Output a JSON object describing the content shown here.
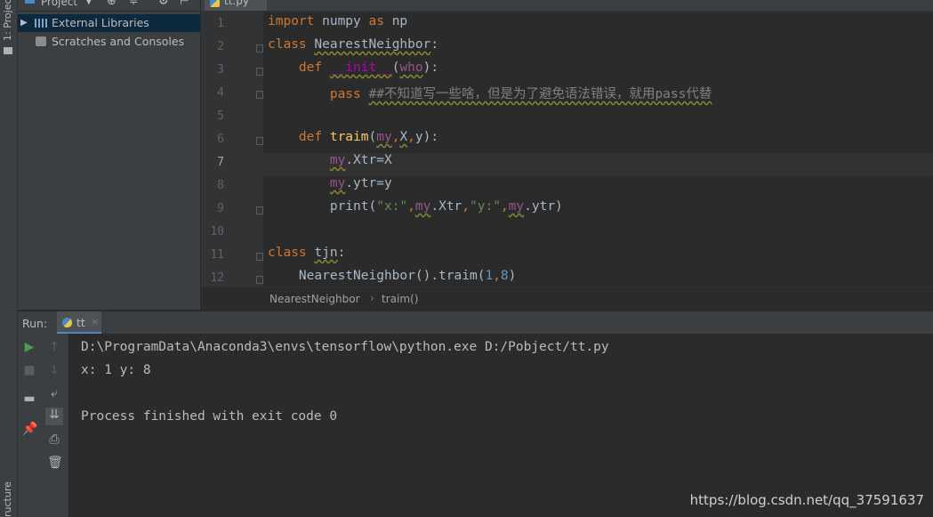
{
  "sidebar": {
    "project_tab": "1: Project",
    "structure_tab": "ructure",
    "project_title": "Project",
    "items": [
      {
        "label": "External Libraries",
        "icon": "library-icon"
      },
      {
        "label": "Scratches and Consoles",
        "icon": "scratches-icon"
      }
    ]
  },
  "editor": {
    "tab_label": "tt.py",
    "current_line": 7,
    "line_numbers": [
      "1",
      "2",
      "3",
      "4",
      "5",
      "6",
      "7",
      "8",
      "9",
      "10",
      "11",
      "12"
    ],
    "lines": [
      [
        [
          "kw",
          "import "
        ],
        [
          "t",
          "numpy "
        ],
        [
          "kw",
          "as "
        ],
        [
          "t",
          "np"
        ]
      ],
      [
        [
          "kw",
          "class "
        ],
        [
          "tw",
          "NearestNeighbor"
        ],
        [
          "t",
          ":"
        ]
      ],
      [
        [
          "t",
          "    "
        ],
        [
          "kw",
          "def "
        ],
        [
          "mw",
          "__init__"
        ],
        [
          "t",
          "("
        ],
        [
          "sw",
          "who"
        ],
        [
          "t",
          "):"
        ]
      ],
      [
        [
          "t",
          "        "
        ],
        [
          "kw",
          "pass "
        ],
        [
          "cw",
          "##不知道写一些啥，但是为了避免语法错误，就用pass代替"
        ]
      ],
      [],
      [
        [
          "t",
          "    "
        ],
        [
          "kw",
          "def "
        ],
        [
          "fn",
          "traim"
        ],
        [
          "t",
          "("
        ],
        [
          "sw",
          "my"
        ],
        [
          "kw",
          ","
        ],
        [
          "tw",
          "X"
        ],
        [
          "kw",
          ","
        ],
        [
          "t",
          "y):"
        ]
      ],
      [
        [
          "t",
          "        "
        ],
        [
          "sw",
          "my"
        ],
        [
          "t",
          ".Xtr=X"
        ]
      ],
      [
        [
          "t",
          "        "
        ],
        [
          "sw",
          "my"
        ],
        [
          "t",
          ".ytr=y"
        ]
      ],
      [
        [
          "t",
          "        "
        ],
        [
          "t",
          "print("
        ],
        [
          "str",
          "\"x:\""
        ],
        [
          "kw",
          ","
        ],
        [
          "sw",
          "my"
        ],
        [
          "t",
          ".Xtr"
        ],
        [
          "kw",
          ","
        ],
        [
          "str",
          "\"y:\""
        ],
        [
          "kw",
          ","
        ],
        [
          "sw",
          "my"
        ],
        [
          "t",
          ".ytr)"
        ]
      ],
      [],
      [
        [
          "kw",
          "class "
        ],
        [
          "tw",
          "tjn"
        ],
        [
          "t",
          ":"
        ]
      ],
      [
        [
          "t",
          "    "
        ],
        [
          "t",
          "NearestNeighbor().traim("
        ],
        [
          "num",
          "1"
        ],
        [
          "kw",
          ","
        ],
        [
          "num",
          "8"
        ],
        [
          "t",
          ")"
        ]
      ]
    ],
    "breadcrumb": [
      "NearestNeighbor",
      "traim()"
    ]
  },
  "run": {
    "label": "Run:",
    "tab": "tt",
    "output": [
      "D:\\ProgramData\\Anaconda3\\envs\\tensorflow\\python.exe D:/Pobject/tt.py",
      "x: 1 y: 8",
      "",
      "Process finished with exit code 0"
    ]
  },
  "watermark": "https://blog.csdn.net/qq_37591637"
}
